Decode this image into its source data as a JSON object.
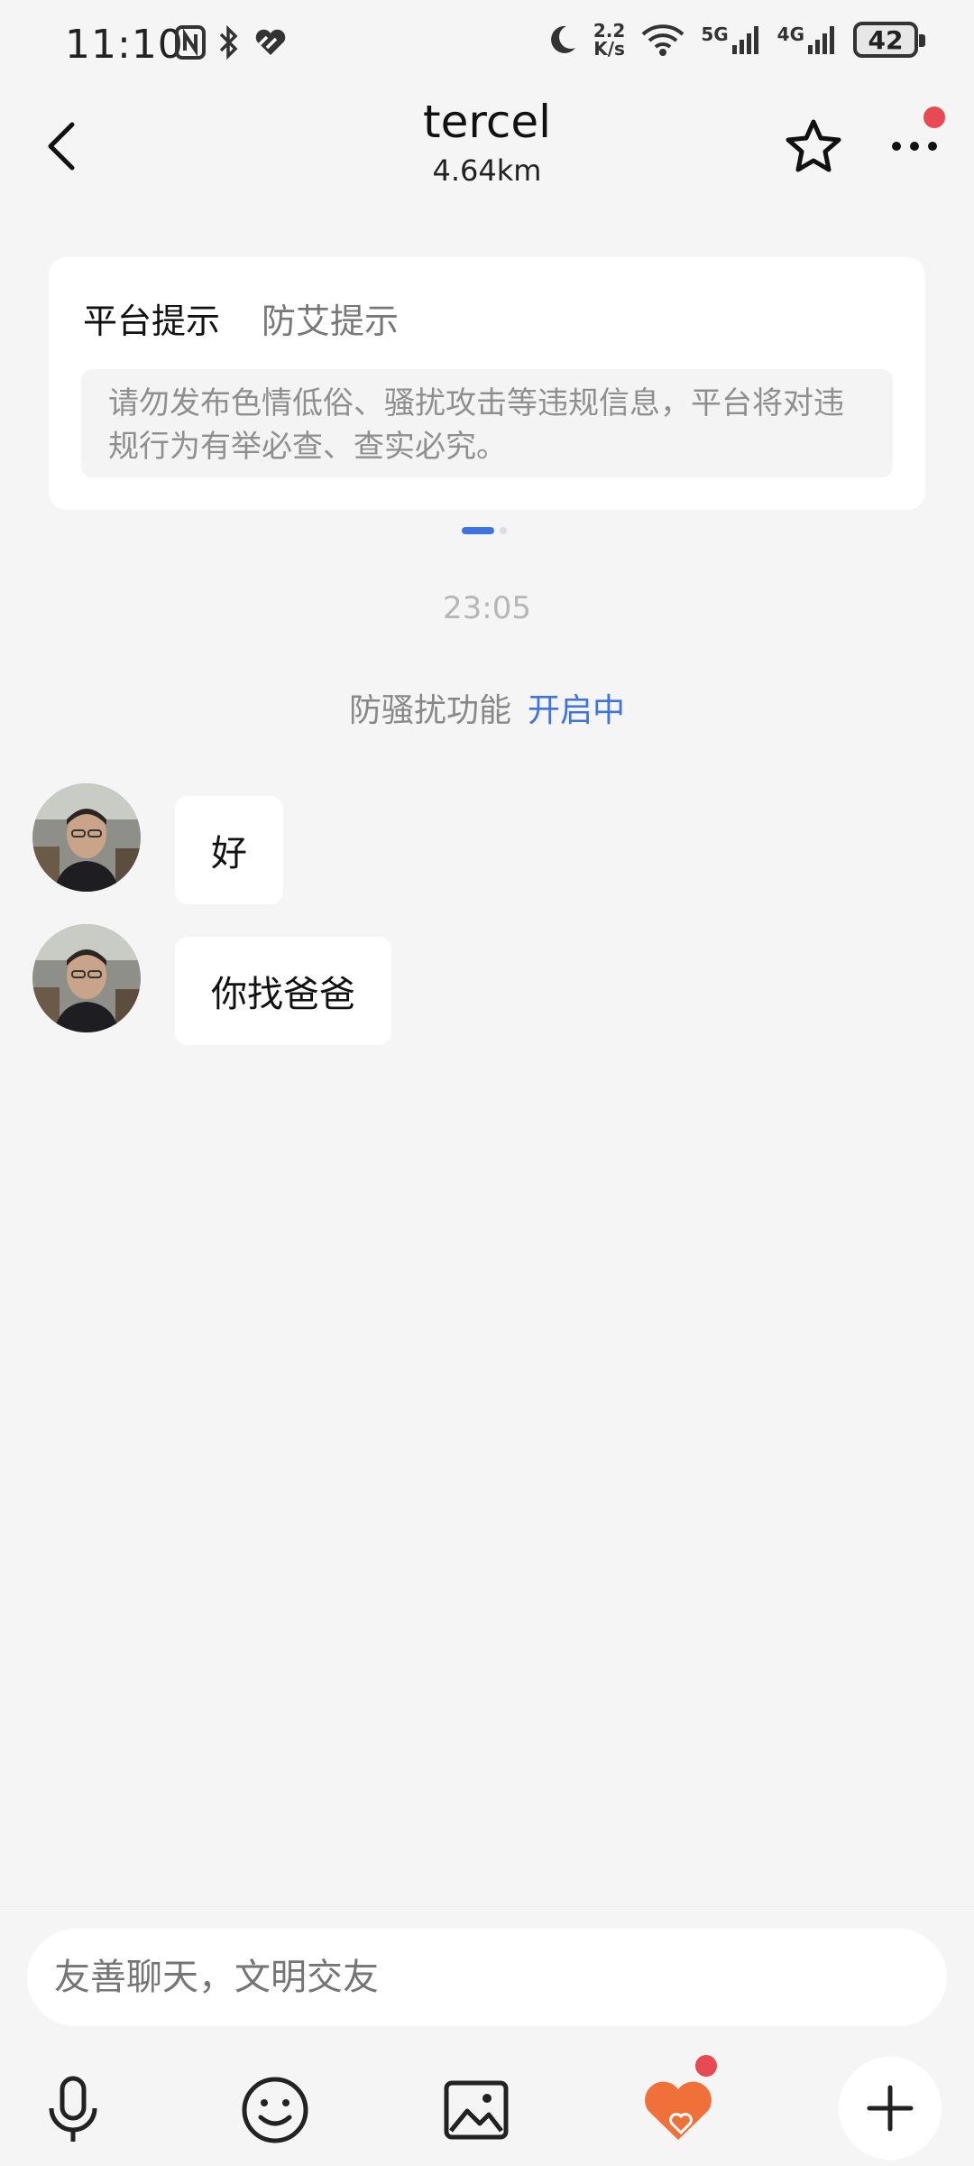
{
  "status_bar": {
    "time": "11:10",
    "speed_top": "2.2",
    "speed_bottom": "K/s",
    "net1": "5G",
    "net2": "4G",
    "battery": "42"
  },
  "header": {
    "title": "tercel",
    "distance": "4.64km"
  },
  "notice": {
    "tabs": [
      {
        "label": "平台提示",
        "active": true
      },
      {
        "label": "防艾提示",
        "active": false
      }
    ],
    "text": "请勿发布色情低俗、骚扰攻击等违规信息，平台将对违规行为有举必查、查实必究。"
  },
  "chat": {
    "timestamp": "23:05",
    "anti_harass_label": "防骚扰功能",
    "anti_harass_status": "开启中",
    "messages": [
      {
        "text": "好"
      },
      {
        "text": "你找爸爸"
      }
    ]
  },
  "input": {
    "placeholder": "友善聊天，文明交友"
  },
  "colors": {
    "accent": "#3f73e0",
    "badge": "#e84a53",
    "heart": "#f0703a"
  }
}
